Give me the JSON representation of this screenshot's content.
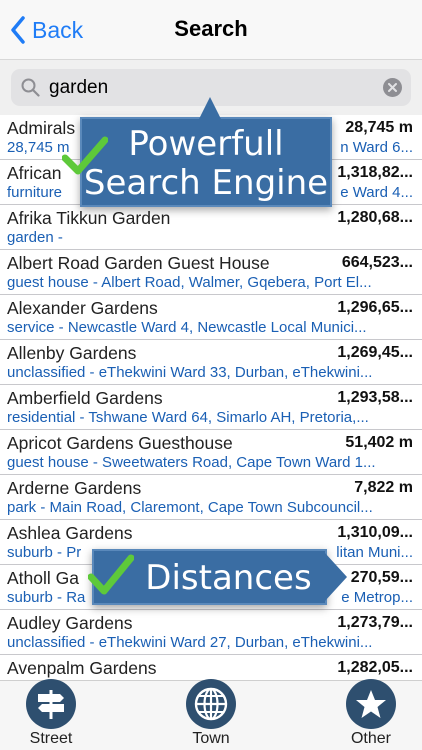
{
  "nav": {
    "back_label": "Back",
    "title": "Search"
  },
  "search": {
    "value": "garden"
  },
  "results": [
    {
      "name": "Admirals",
      "distance": "28,745 m",
      "detail": "28,745 m",
      "detail_right": "n Ward 6..."
    },
    {
      "name": "African",
      "distance": "1,318,82...",
      "detail": "furniture",
      "detail_right": "e Ward 4..."
    },
    {
      "name": "Afrika Tikkun Garden",
      "distance": "1,280,68...",
      "detail": "garden -",
      "detail_right": ""
    },
    {
      "name": "Albert Road Garden Guest House",
      "distance": "664,523...",
      "detail": "guest house - Albert Road, Walmer, Gqebera, Port El...",
      "detail_right": ""
    },
    {
      "name": "Alexander Gardens",
      "distance": "1,296,65...",
      "detail": "service - Newcastle Ward 4, Newcastle Local Munici...",
      "detail_right": ""
    },
    {
      "name": "Allenby Gardens",
      "distance": "1,269,45...",
      "detail": "unclassified - eThekwini Ward 33, Durban, eThekwini...",
      "detail_right": ""
    },
    {
      "name": "Amberfield Gardens",
      "distance": "1,293,58...",
      "detail": "residential - Tshwane Ward 64, Simarlo AH, Pretoria,...",
      "detail_right": ""
    },
    {
      "name": "Apricot Gardens Guesthouse",
      "distance": "51,402 m",
      "detail": "guest house - Sweetwaters Road, Cape Town Ward 1...",
      "detail_right": ""
    },
    {
      "name": "Arderne Gardens",
      "distance": "7,822 m",
      "detail": "park - Main Road, Claremont, Cape Town Subcouncil...",
      "detail_right": ""
    },
    {
      "name": "Ashlea Gardens",
      "distance": "1,310,09...",
      "detail": "suburb - Pr",
      "detail_right": "litan Muni..."
    },
    {
      "name": "Atholl Ga",
      "distance": "270,59...",
      "detail": "suburb - Ra",
      "detail_right": "e Metrop..."
    },
    {
      "name": "Audley Gardens",
      "distance": "1,273,79...",
      "detail": "unclassified - eThekwini Ward 27, Durban, eThekwini...",
      "detail_right": ""
    },
    {
      "name": "Avenpalm Gardens",
      "distance": "1,282,05...",
      "detail": "",
      "detail_right": ""
    }
  ],
  "banners": {
    "top_line1": "Powerfull",
    "top_line2": "Search Engine",
    "bottom": "Distances"
  },
  "tabs": [
    {
      "label": "Street",
      "icon": "signpost-icon"
    },
    {
      "label": "Town",
      "icon": "globe-icon"
    },
    {
      "label": "Other",
      "icon": "star-icon"
    }
  ],
  "colors": {
    "accent": "#1f7cf6",
    "detail_text": "#1a5fb4",
    "banner": "#3a6da3",
    "check": "#5ec93a",
    "tab_icon": "#2e4f6f"
  }
}
